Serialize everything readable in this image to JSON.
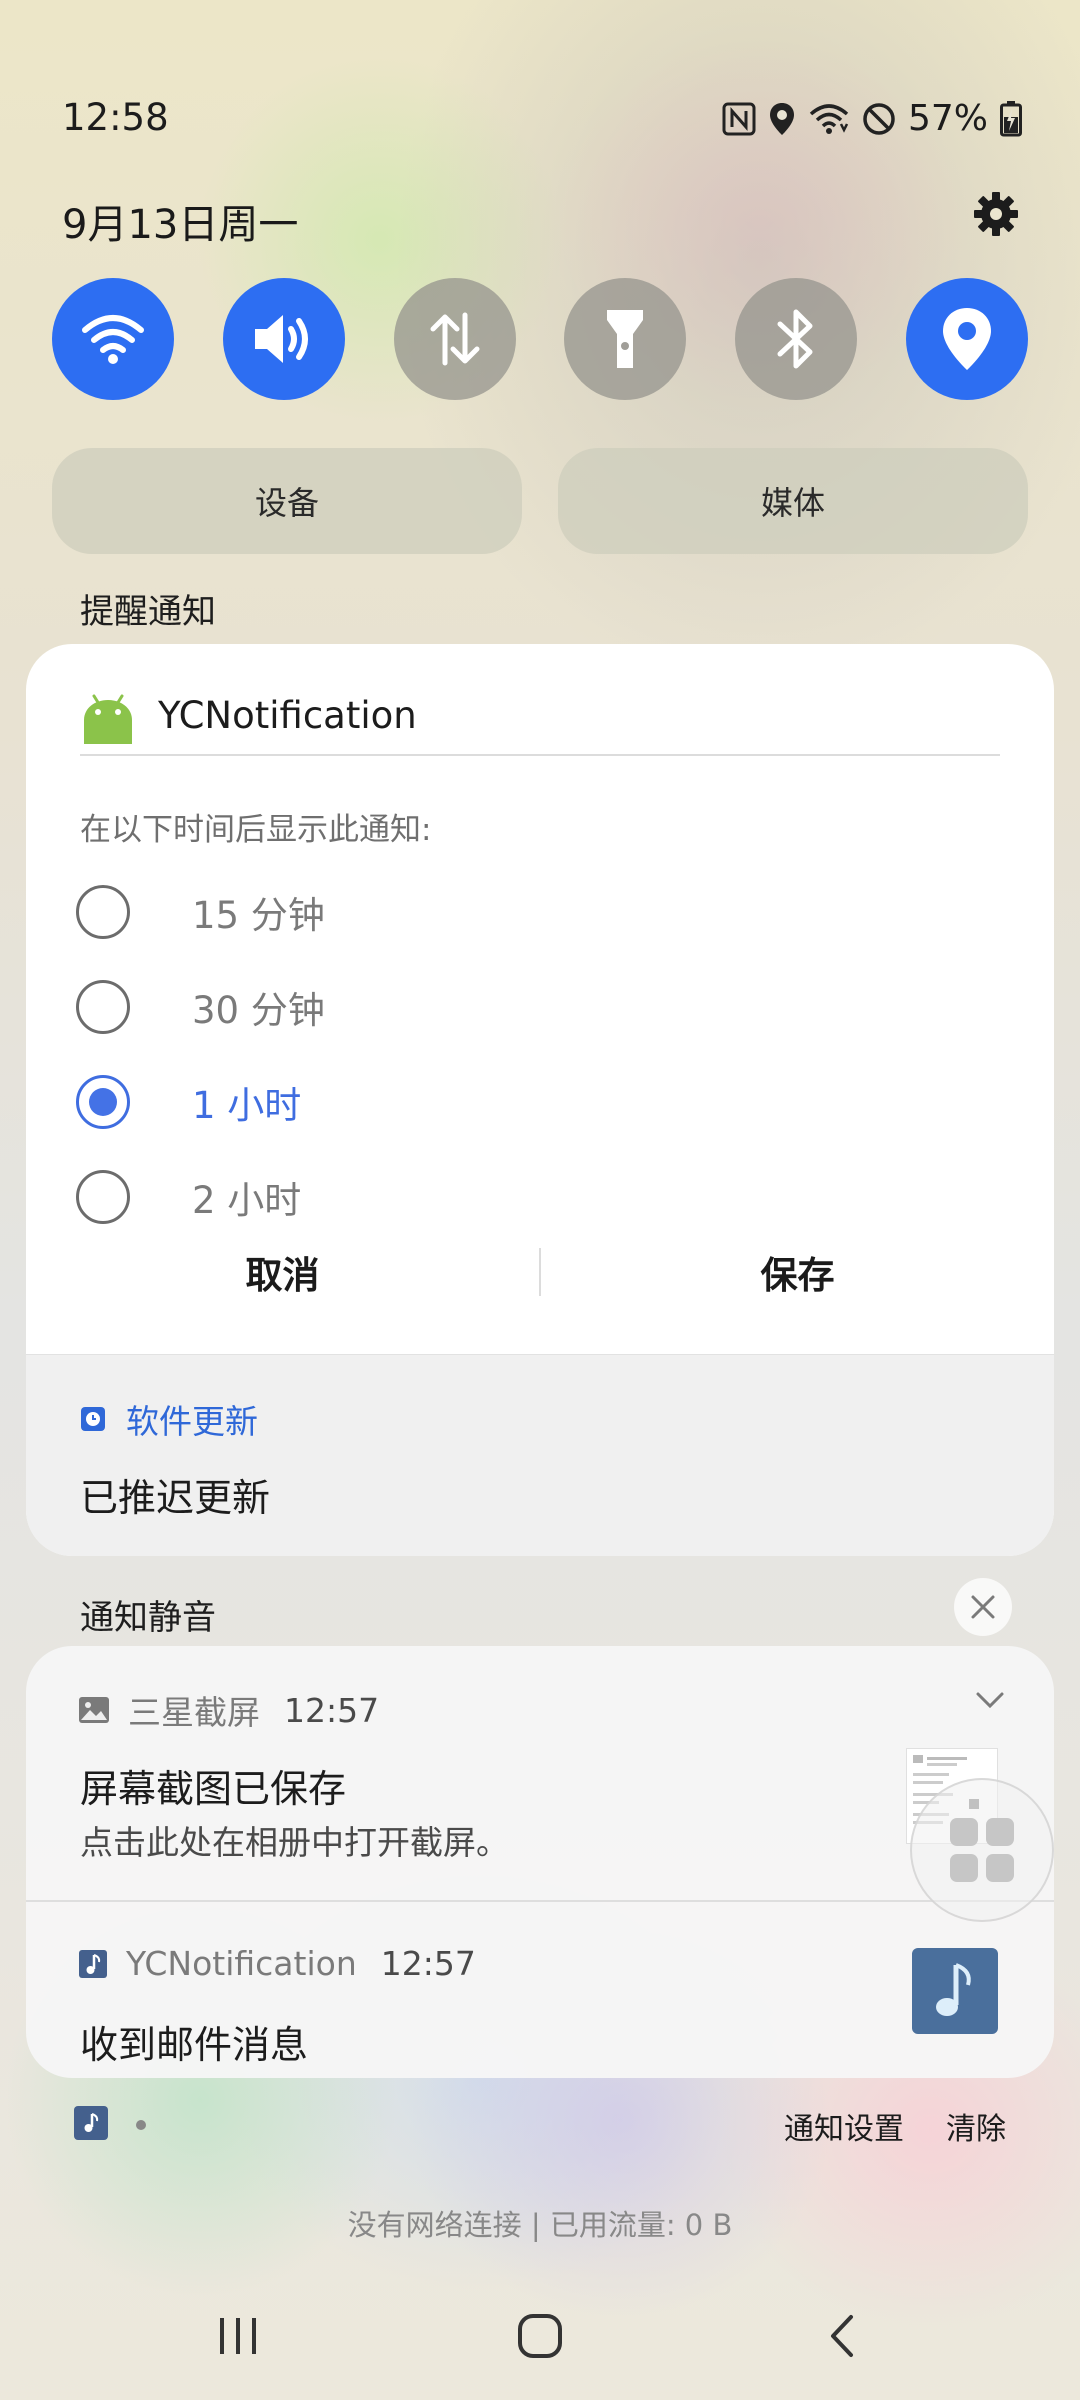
{
  "status_bar": {
    "time": "12:58",
    "battery": "57%",
    "icons": [
      "nfc-icon",
      "location-icon",
      "wifi-icon",
      "do-not-disturb-icon",
      "battery-charging-icon"
    ]
  },
  "header": {
    "date": "9月13日周一",
    "settings_icon": "gear-icon"
  },
  "quick_settings": [
    {
      "name": "wifi",
      "icon": "wifi-icon",
      "on": true
    },
    {
      "name": "sound",
      "icon": "volume-icon",
      "on": true
    },
    {
      "name": "mobile-data",
      "icon": "data-arrows-icon",
      "on": false
    },
    {
      "name": "flashlight",
      "icon": "flashlight-icon",
      "on": false
    },
    {
      "name": "bluetooth",
      "icon": "bluetooth-icon",
      "on": false
    },
    {
      "name": "location",
      "icon": "location-pin-icon",
      "on": true
    }
  ],
  "pills": {
    "devices": "设备",
    "media": "媒体"
  },
  "alerts_section": {
    "label": "提醒通知"
  },
  "snooze_card": {
    "app_name": "YCNotification",
    "prompt": "在以下时间后显示此通知:",
    "options": [
      {
        "label": "15 分钟",
        "selected": false
      },
      {
        "label": "30 分钟",
        "selected": false
      },
      {
        "label": "1 小时",
        "selected": true
      },
      {
        "label": "2 小时",
        "selected": false
      }
    ],
    "cancel": "取消",
    "save": "保存",
    "update_app": "软件更新",
    "update_text": "已推迟更新"
  },
  "silent_section": {
    "label": "通知静音"
  },
  "notifications": [
    {
      "app": "三星截屏",
      "time": "12:57",
      "title": "屏幕截图已保存",
      "body": "点击此处在相册中打开截屏。"
    },
    {
      "app": "YCNotification",
      "time": "12:57",
      "title": "收到邮件消息"
    }
  ],
  "footer": {
    "settings": "通知设置",
    "clear": "清除",
    "network": "没有网络连接 | 已用流量: 0 B"
  },
  "colors": {
    "accent": "#2d6ef2",
    "selected": "#3f6de0",
    "tile_off": "#96948e"
  }
}
